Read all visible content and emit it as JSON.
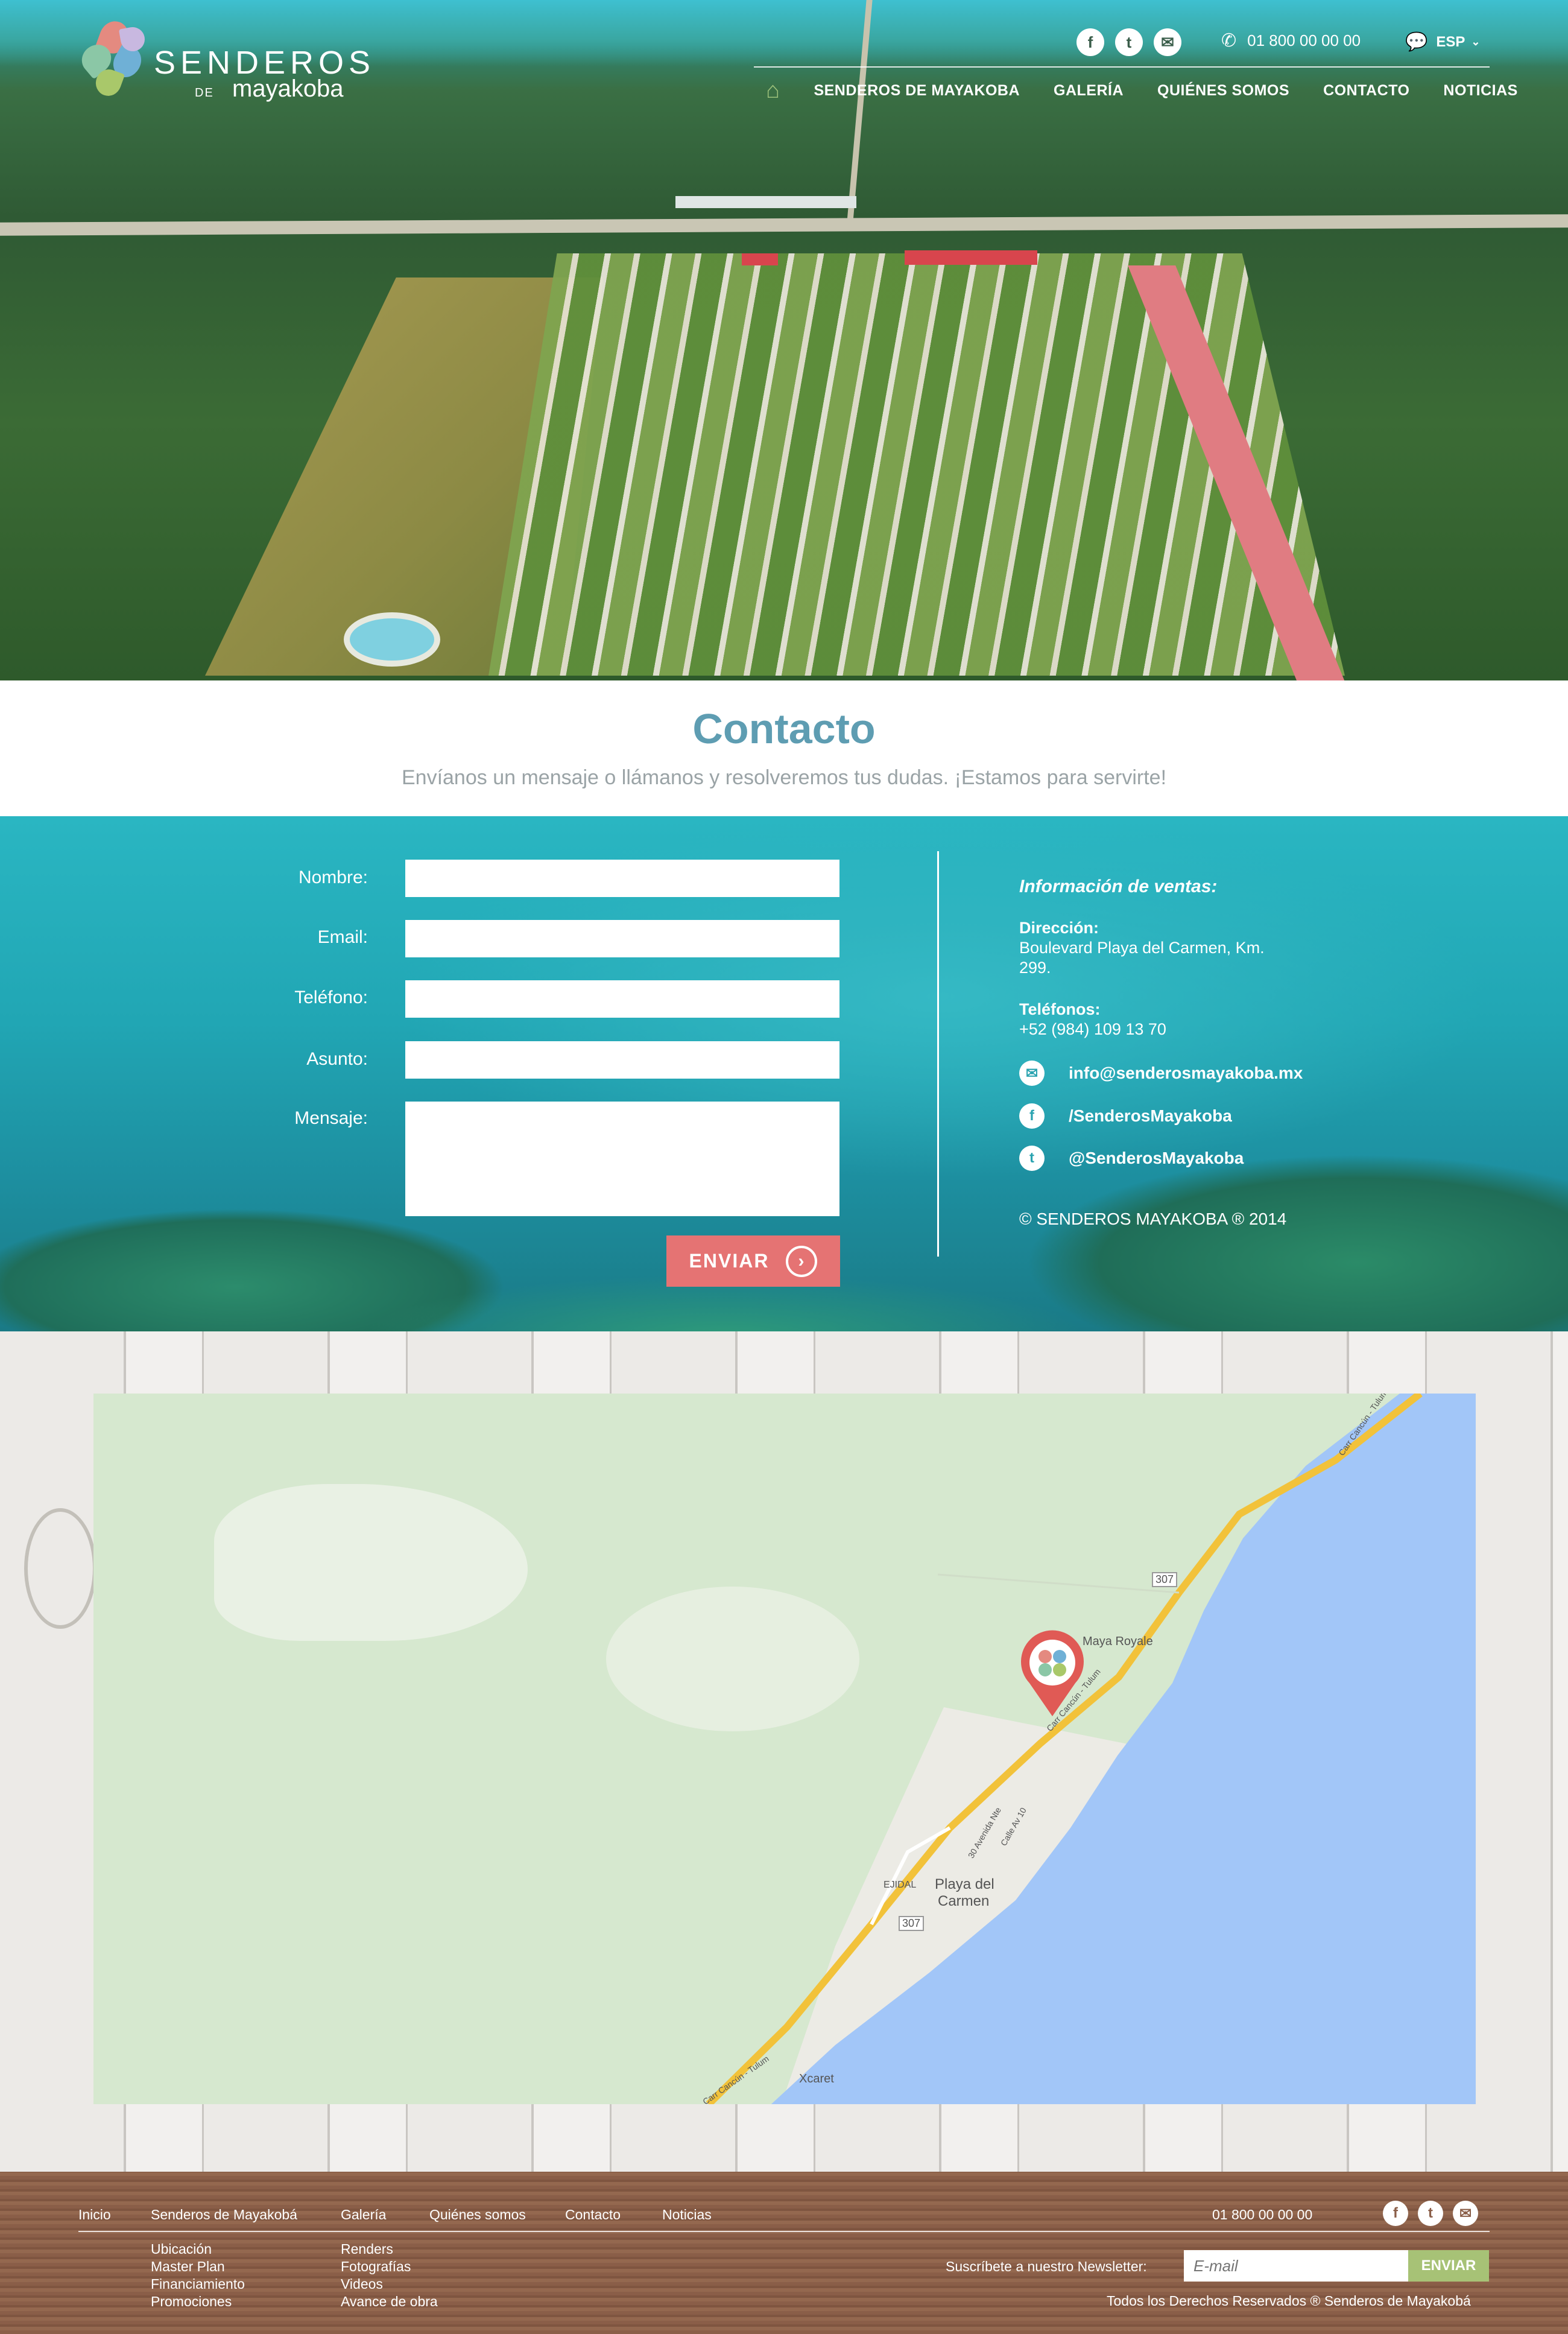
{
  "header": {
    "logo": {
      "title": "SENDEROS",
      "de": "DE",
      "subtitle": "mayakoba"
    },
    "social": [
      {
        "icon": "facebook-icon",
        "glyph": "f"
      },
      {
        "icon": "twitter-icon",
        "glyph": "t"
      },
      {
        "icon": "email-icon",
        "glyph": "✉"
      }
    ],
    "phone": "01 800 00 00 00",
    "language": "ESP",
    "nav": [
      "SENDEROS DE MAYAKOBA",
      "GALERÍA",
      "QUIÉNES SOMOS",
      "CONTACTO",
      "NOTICIAS"
    ]
  },
  "contact": {
    "title": "Contacto",
    "subtitle": "Envíanos un mensaje o llámanos y resolveremos tus dudas. ¡Estamos para servirte!"
  },
  "form": {
    "labels": {
      "name": "Nombre:",
      "email": "Email:",
      "phone": "Teléfono:",
      "subject": "Asunto:",
      "message": "Mensaje:"
    },
    "submit": "ENVIAR"
  },
  "sales_info": {
    "heading": "Información de ventas:",
    "address_label": "Dirección:",
    "address_line1": "Boulevard Playa del Carmen, Km.",
    "address_line2": "299.",
    "phones_label": "Teléfonos:",
    "phone": "+52 (984) 109 13 70",
    "email": "info@senderosmayakoba.mx",
    "facebook": "/SenderosMayakoba",
    "twitter": "@SenderosMayakoba",
    "copyright": "© SENDEROS MAYAKOBA ® 2014"
  },
  "map": {
    "labels": {
      "maya_royale": "Maya Royale",
      "playa1": "Playa del",
      "playa2": "Carmen",
      "ejidal": "EJIDAL",
      "xcaret": "Xcaret",
      "hwy307a": "307",
      "hwy307b": "307",
      "road1": "Carr Cancún - Tulum",
      "road2": "Carr Cancún - Tulum",
      "road3": "Carr Cancún - Tulum",
      "road4": "30 Avenida Nte",
      "road5": "Calle Av 10"
    }
  },
  "footer": {
    "nav": [
      "Inicio",
      "Senderos de Mayakobá",
      "Galería",
      "Quiénes somos",
      "Contacto",
      "Noticias"
    ],
    "sub1": [
      "Ubicación",
      "Master Plan",
      "Financiamiento",
      "Promociones"
    ],
    "sub2": [
      "Renders",
      "Fotografías",
      "Videos",
      "Avance de obra"
    ],
    "phone": "01 800 00 00 00",
    "newsletter_label": "Suscríbete a nuestro Newsletter:",
    "newsletter_placeholder": "E-mail",
    "newsletter_button": "ENVIAR",
    "rights": "Todos los Derechos Reservados ® Senderos de Mayakobá"
  },
  "colors": {
    "accent": "#5e9db2",
    "button": "#e57373",
    "newsletter": "#a7c276"
  }
}
